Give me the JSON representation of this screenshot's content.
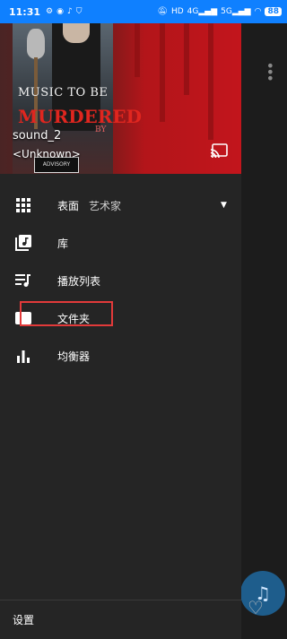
{
  "status_bar": {
    "time": "11:31",
    "left_icons": [
      "settings-icon",
      "vpn-icon",
      "tiktok-icon",
      "shield-icon"
    ],
    "right_icons": [
      "mute-icon",
      "hd-icon",
      "signal-4g-icon",
      "signal-5g-icon",
      "wifi-icon"
    ],
    "battery": "88"
  },
  "album": {
    "title_line1": "MUSIC TO BE",
    "title_line2": "MURDERED",
    "title_line3": "BY",
    "advisory": "ADVISORY"
  },
  "now_playing": {
    "title": "sound_2",
    "artist": "<Unknown>"
  },
  "menu": {
    "items": [
      {
        "label": "表面",
        "sub": "艺术家",
        "icon": "grid-icon"
      },
      {
        "label": "库",
        "icon": "library-icon"
      },
      {
        "label": "播放列表",
        "icon": "playlist-icon"
      },
      {
        "label": "文件夹",
        "icon": "folder-icon"
      },
      {
        "label": "均衡器",
        "icon": "equalizer-icon"
      }
    ]
  },
  "footer": {
    "settings_label": "设置"
  },
  "colors": {
    "status_bar": "#0f80ff",
    "drawer_bg": "#252525",
    "highlight": "#e23a3a",
    "fab": "#1e5d8c"
  }
}
